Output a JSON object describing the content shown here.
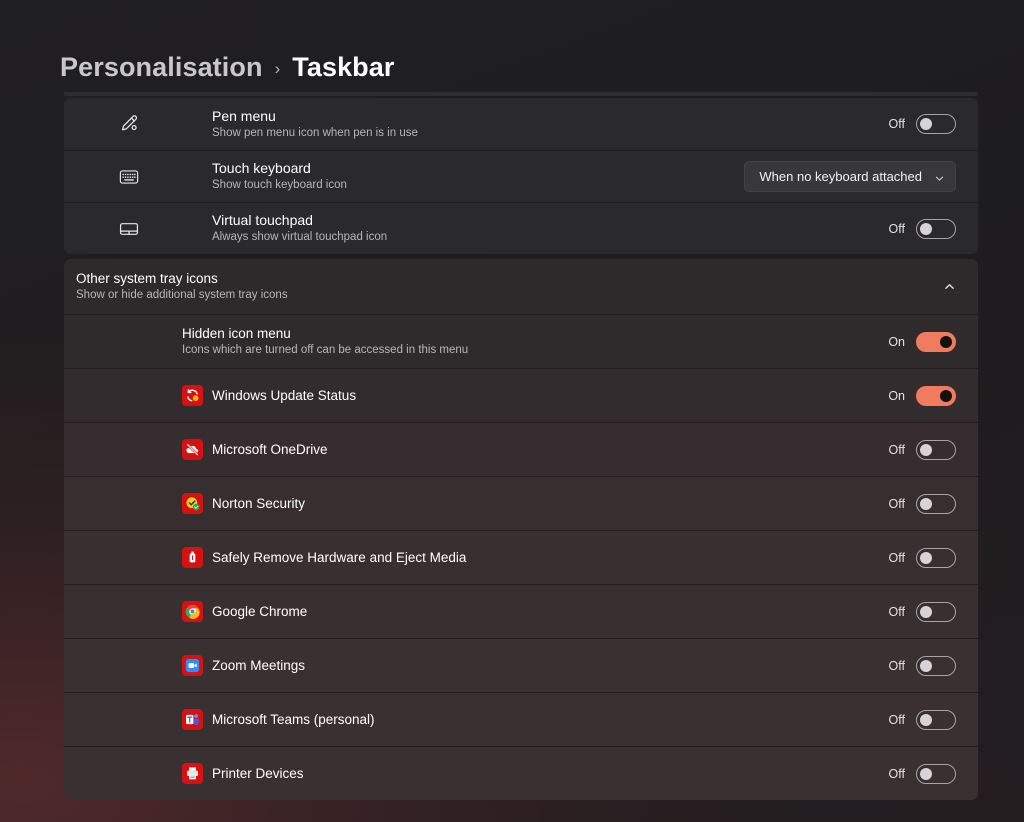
{
  "breadcrumb": {
    "root": "Personalisation",
    "separator": "›",
    "current": "Taskbar"
  },
  "accent_colors": {
    "toggle_on": "#f07b5e",
    "toggle_on_knob": "#14110f",
    "app_tile_red": "#d51111",
    "card_background": "#2a292b",
    "page_background": "#1b1a1c"
  },
  "settings_rows": [
    {
      "icon": "pen-icon",
      "title": "Pen menu",
      "subtitle": "Show pen menu icon when pen is in use",
      "control": "toggle",
      "state_label": "Off",
      "state": "off"
    },
    {
      "icon": "touch-keyboard-icon",
      "title": "Touch keyboard",
      "subtitle": "Show touch keyboard icon",
      "control": "dropdown",
      "dropdown_value": "When no keyboard attached"
    },
    {
      "icon": "touchpad-icon",
      "title": "Virtual touchpad",
      "subtitle": "Always show virtual touchpad icon",
      "control": "toggle",
      "state_label": "Off",
      "state": "off"
    }
  ],
  "expander": {
    "title": "Other system tray icons",
    "subtitle": "Show or hide additional system tray icons",
    "chevron": "chevron-up-icon",
    "expanded": true,
    "hidden_icon_menu": {
      "title": "Hidden icon menu",
      "subtitle": "Icons which are turned off can be accessed in this menu",
      "state_label": "On",
      "state": "on"
    },
    "tray_apps": [
      {
        "icon": "windows-update-icon",
        "label": "Windows Update Status",
        "state_label": "On",
        "state": "on"
      },
      {
        "icon": "onedrive-paused-icon",
        "label": "Microsoft OneDrive",
        "state_label": "Off",
        "state": "off"
      },
      {
        "icon": "norton-security-icon",
        "label": "Norton Security",
        "state_label": "Off",
        "state": "off"
      },
      {
        "icon": "safely-remove-hardware-icon",
        "label": "Safely Remove Hardware and Eject Media",
        "state_label": "Off",
        "state": "off"
      },
      {
        "icon": "google-chrome-icon",
        "label": "Google Chrome",
        "state_label": "Off",
        "state": "off"
      },
      {
        "icon": "zoom-meetings-icon",
        "label": "Zoom Meetings",
        "state_label": "Off",
        "state": "off"
      },
      {
        "icon": "microsoft-teams-icon",
        "label": "Microsoft Teams (personal)",
        "state_label": "Off",
        "state": "off"
      },
      {
        "icon": "printer-devices-icon",
        "label": "Printer Devices",
        "state_label": "Off",
        "state": "off"
      }
    ]
  }
}
